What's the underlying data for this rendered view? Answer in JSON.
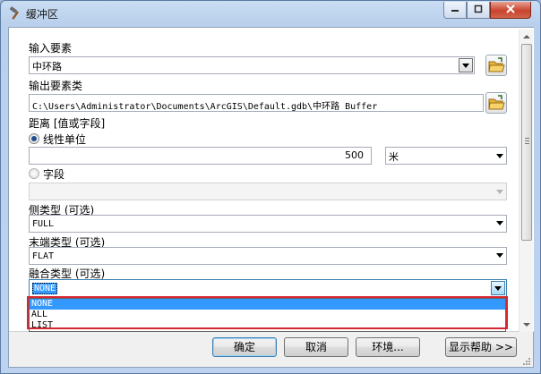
{
  "window": {
    "title": "缓冲区"
  },
  "input_features": {
    "label": "输入要素",
    "value": "中环路"
  },
  "output_feature_class": {
    "label": "输出要素类",
    "value": "C:\\Users\\Administrator\\Documents\\ArcGIS\\Default.gdb\\中环路_Buffer"
  },
  "distance": {
    "label": "距离 [值或字段]",
    "linear_unit_label": "线性单位",
    "linear_unit_value": "500",
    "unit_value": "米",
    "field_label": "字段",
    "field_value": ""
  },
  "side_type": {
    "label": "侧类型 (可选)",
    "value": "FULL"
  },
  "end_type": {
    "label": "末端类型 (可选)",
    "value": "FLAT"
  },
  "dissolve_type": {
    "label": "融合类型 (可选)",
    "value": "NONE",
    "options": [
      "NONE",
      "ALL",
      "LIST"
    ],
    "selected_option": "NONE"
  },
  "footer": {
    "ok": "确定",
    "cancel": "取消",
    "environments": "环境...",
    "show_help": "显示帮助 >>"
  },
  "colors": {
    "highlight": "#d6262f",
    "selection": "#3399ff"
  },
  "icons": [
    "hammer-icon",
    "help-icon",
    "maximize-icon",
    "close-icon",
    "open-folder-icon",
    "chevron-down-icon"
  ]
}
